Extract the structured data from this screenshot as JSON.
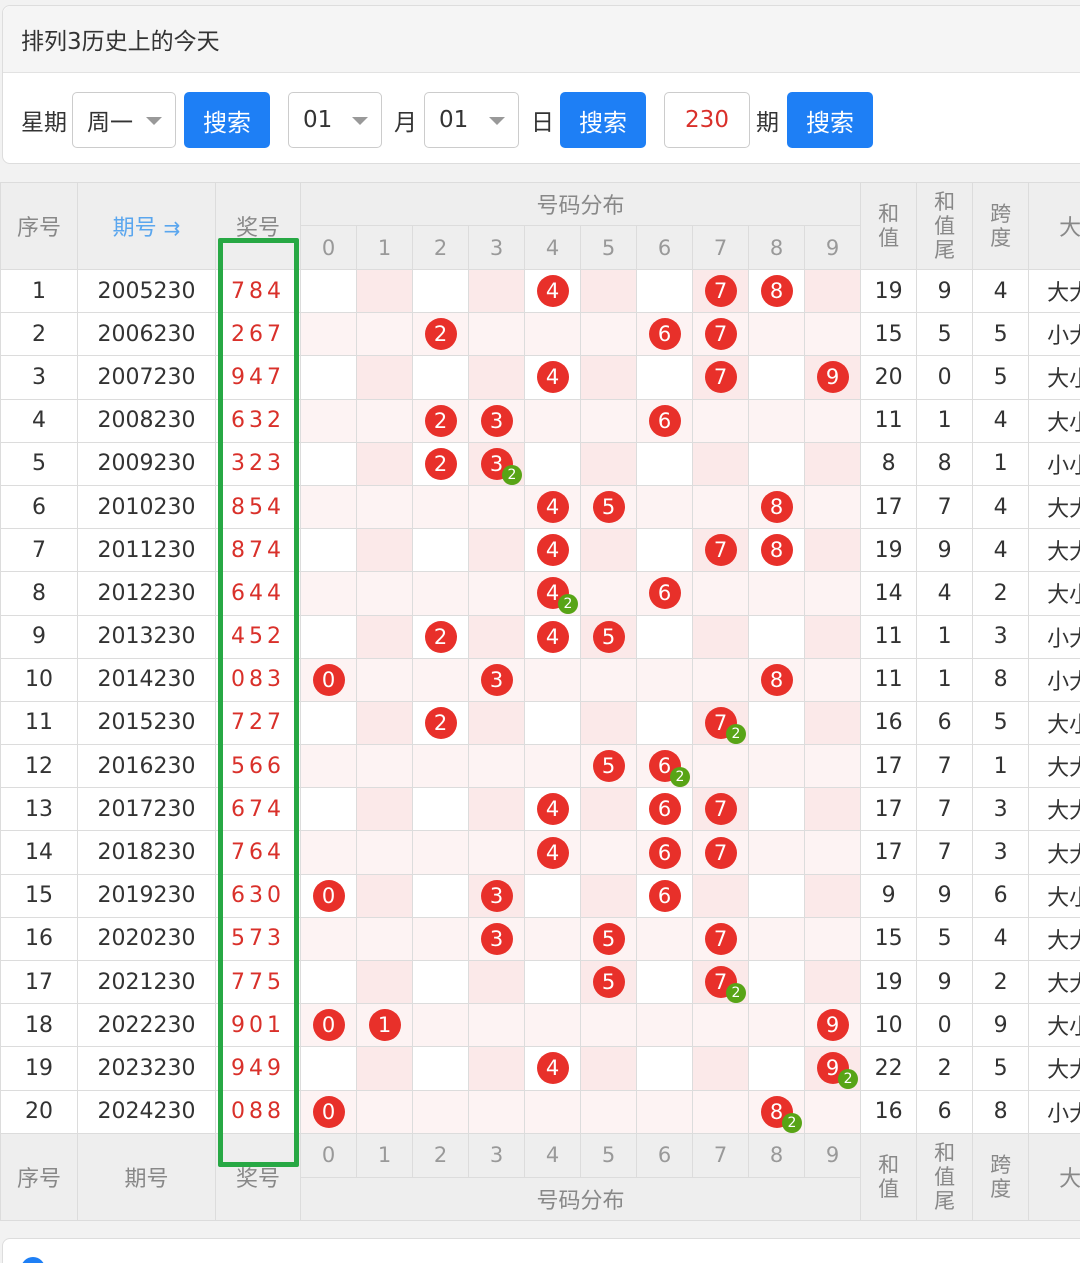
{
  "panel": {
    "title": "排列3历史上的今天",
    "week_label": "星期",
    "week_value": "周一",
    "month_value": "01",
    "month_label": "月",
    "day_value": "01",
    "day_label": "日",
    "issue_value": "230",
    "issue_label": "期",
    "search_label": "搜索"
  },
  "table": {
    "headers": {
      "index": "序号",
      "issue": "期号",
      "sort_icon": "⇉",
      "award": "奖号",
      "distribution": "号码分布",
      "sum": "和值",
      "sum_tail": "和值尾",
      "span": "跨度",
      "size": "大"
    },
    "digits": [
      "0",
      "1",
      "2",
      "3",
      "4",
      "5",
      "6",
      "7",
      "8",
      "9"
    ],
    "rows": [
      {
        "idx": "1",
        "issue": "2005230",
        "award": "784",
        "nums": [
          4,
          7,
          8
        ],
        "repeat": {},
        "sum": "19",
        "tail": "9",
        "span": "4",
        "size": "大大"
      },
      {
        "idx": "2",
        "issue": "2006230",
        "award": "267",
        "nums": [
          2,
          6,
          7
        ],
        "repeat": {},
        "sum": "15",
        "tail": "5",
        "span": "5",
        "size": "小大"
      },
      {
        "idx": "3",
        "issue": "2007230",
        "award": "947",
        "nums": [
          4,
          7,
          9
        ],
        "repeat": {},
        "sum": "20",
        "tail": "0",
        "span": "5",
        "size": "大小"
      },
      {
        "idx": "4",
        "issue": "2008230",
        "award": "632",
        "nums": [
          2,
          3,
          6
        ],
        "repeat": {},
        "sum": "11",
        "tail": "1",
        "span": "4",
        "size": "大小"
      },
      {
        "idx": "5",
        "issue": "2009230",
        "award": "323",
        "nums": [
          2,
          3
        ],
        "repeat": {
          "3": "2"
        },
        "sum": "8",
        "tail": "8",
        "span": "1",
        "size": "小小"
      },
      {
        "idx": "6",
        "issue": "2010230",
        "award": "854",
        "nums": [
          4,
          5,
          8
        ],
        "repeat": {},
        "sum": "17",
        "tail": "7",
        "span": "4",
        "size": "大大"
      },
      {
        "idx": "7",
        "issue": "2011230",
        "award": "874",
        "nums": [
          4,
          7,
          8
        ],
        "repeat": {},
        "sum": "19",
        "tail": "9",
        "span": "4",
        "size": "大大"
      },
      {
        "idx": "8",
        "issue": "2012230",
        "award": "644",
        "nums": [
          4,
          6
        ],
        "repeat": {
          "4": "2"
        },
        "sum": "14",
        "tail": "4",
        "span": "2",
        "size": "大小"
      },
      {
        "idx": "9",
        "issue": "2013230",
        "award": "452",
        "nums": [
          2,
          4,
          5
        ],
        "repeat": {},
        "sum": "11",
        "tail": "1",
        "span": "3",
        "size": "小大"
      },
      {
        "idx": "10",
        "issue": "2014230",
        "award": "083",
        "nums": [
          0,
          3,
          8
        ],
        "repeat": {},
        "sum": "11",
        "tail": "1",
        "span": "8",
        "size": "小大"
      },
      {
        "idx": "11",
        "issue": "2015230",
        "award": "727",
        "nums": [
          2,
          7
        ],
        "repeat": {
          "7": "2"
        },
        "sum": "16",
        "tail": "6",
        "span": "5",
        "size": "大小"
      },
      {
        "idx": "12",
        "issue": "2016230",
        "award": "566",
        "nums": [
          5,
          6
        ],
        "repeat": {
          "6": "2"
        },
        "sum": "17",
        "tail": "7",
        "span": "1",
        "size": "大大"
      },
      {
        "idx": "13",
        "issue": "2017230",
        "award": "674",
        "nums": [
          4,
          6,
          7
        ],
        "repeat": {},
        "sum": "17",
        "tail": "7",
        "span": "3",
        "size": "大大"
      },
      {
        "idx": "14",
        "issue": "2018230",
        "award": "764",
        "nums": [
          4,
          6,
          7
        ],
        "repeat": {},
        "sum": "17",
        "tail": "7",
        "span": "3",
        "size": "大大"
      },
      {
        "idx": "15",
        "issue": "2019230",
        "award": "630",
        "nums": [
          0,
          3,
          6
        ],
        "repeat": {},
        "sum": "9",
        "tail": "9",
        "span": "6",
        "size": "大小"
      },
      {
        "idx": "16",
        "issue": "2020230",
        "award": "573",
        "nums": [
          3,
          5,
          7
        ],
        "repeat": {},
        "sum": "15",
        "tail": "5",
        "span": "4",
        "size": "大大"
      },
      {
        "idx": "17",
        "issue": "2021230",
        "award": "775",
        "nums": [
          5,
          7
        ],
        "repeat": {
          "7": "2"
        },
        "sum": "19",
        "tail": "9",
        "span": "2",
        "size": "大大"
      },
      {
        "idx": "18",
        "issue": "2022230",
        "award": "901",
        "nums": [
          0,
          1,
          9
        ],
        "repeat": {},
        "sum": "10",
        "tail": "0",
        "span": "9",
        "size": "大小"
      },
      {
        "idx": "19",
        "issue": "2023230",
        "award": "949",
        "nums": [
          4,
          9
        ],
        "repeat": {
          "9": "2"
        },
        "sum": "22",
        "tail": "2",
        "span": "5",
        "size": "大大"
      },
      {
        "idx": "20",
        "issue": "2024230",
        "award": "088",
        "nums": [
          0,
          8
        ],
        "repeat": {
          "8": "2"
        },
        "sum": "16",
        "tail": "6",
        "span": "8",
        "size": "小大"
      }
    ]
  }
}
